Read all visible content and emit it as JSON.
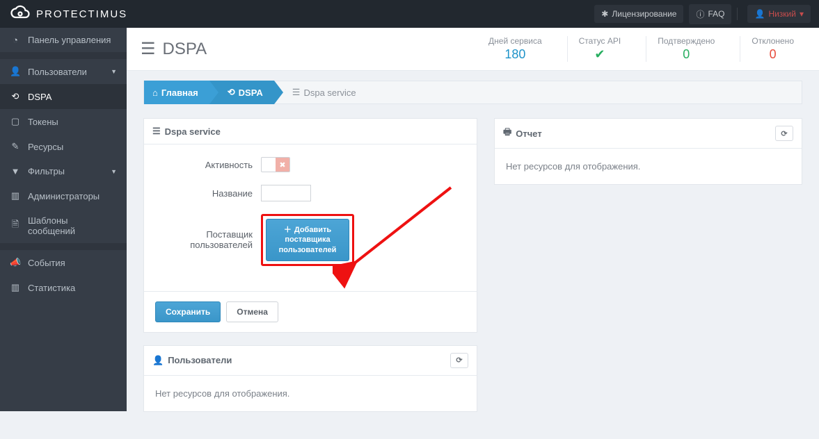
{
  "brand": "PROTECTIMUS",
  "top": {
    "licensing": "Лицензирование",
    "faq": "FAQ",
    "user": "Низкий"
  },
  "sidebar": {
    "items": [
      {
        "label": "Панель управления",
        "icon": "dashboard"
      },
      {
        "label": "Пользователи",
        "icon": "user",
        "caret": true
      },
      {
        "label": "DSPA",
        "icon": "sync",
        "active": true
      },
      {
        "label": "Токены",
        "icon": "device"
      },
      {
        "label": "Ресурсы",
        "icon": "edit"
      },
      {
        "label": "Фильтры",
        "icon": "funnel",
        "caret": true
      },
      {
        "label": "Администраторы",
        "icon": "bars"
      },
      {
        "label": "Шаблоны сообщений",
        "icon": "doc"
      },
      {
        "label": "События",
        "icon": "megaphone"
      },
      {
        "label": "Статистика",
        "icon": "bars"
      }
    ]
  },
  "page": {
    "title": "DSPA",
    "stats": {
      "days_label": "Дней сервиса",
      "days": "180",
      "api_label": "Статус API",
      "api_ok": "✔",
      "confirmed_label": "Подтверждено",
      "confirmed": "0",
      "rejected_label": "Отклонено",
      "rejected": "0"
    }
  },
  "breadcrumb": {
    "home": "Главная",
    "dspa": "DSPA",
    "leaf": "Dspa service"
  },
  "panels": {
    "service": {
      "title": "Dspa service",
      "fields": {
        "activity": "Активность",
        "name": "Название",
        "provider": "Поставщик пользователей"
      },
      "add_provider_l1": "Добавить",
      "add_provider_l2": "поставщика",
      "add_provider_l3": "пользователей",
      "save": "Сохранить",
      "cancel": "Отмена"
    },
    "users": {
      "title": "Пользователи",
      "empty": "Нет ресурсов для отображения."
    },
    "report": {
      "title": "Отчет",
      "empty": "Нет ресурсов для отображения."
    }
  }
}
